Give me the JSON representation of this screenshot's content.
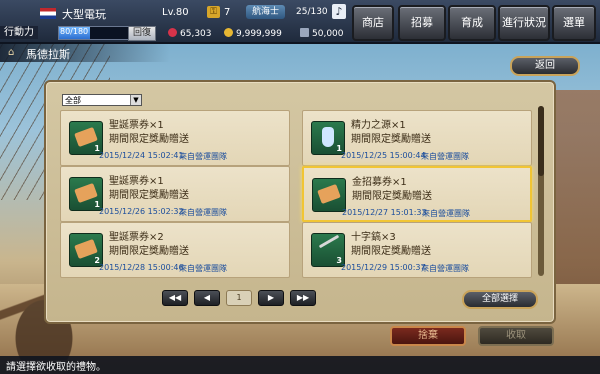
{
  "header": {
    "player_name": "大型電玩",
    "level": "Lv.80",
    "keys": "7",
    "job": "航海士",
    "crew": "25/130",
    "music_icon": "music-note-icon",
    "stamina_label": "行動力",
    "stamina_text": "80/180",
    "stamina_fraction": 0.44,
    "recover_label": "回復",
    "gems": "65,303",
    "gold": "9,999,999",
    "capacity": "50,000"
  },
  "nav": {
    "shop": "商店",
    "recruit": "招募",
    "training": "育成",
    "progress": "進行狀況",
    "menu": "選單"
  },
  "location": {
    "name": "馬德拉斯",
    "back_label": "返回"
  },
  "filter": {
    "selected": "全部"
  },
  "items": [
    {
      "name": "聖誕票券×1",
      "desc": "期間限定獎勵贈送",
      "date": "2015/12/24  15:02:41",
      "source": "來自營運團隊",
      "count": "1",
      "icon": "ticket"
    },
    {
      "name": "精力之源×1",
      "desc": "期間限定獎勵贈送",
      "date": "2015/12/25  15:00:44",
      "source": "來自營運團隊",
      "count": "1",
      "icon": "potion"
    },
    {
      "name": "聖誕票券×1",
      "desc": "期間限定獎勵贈送",
      "date": "2015/12/26  15:02:32",
      "source": "來自營運團隊",
      "count": "1",
      "icon": "ticket"
    },
    {
      "name": "金招募券×1",
      "desc": "期間限定獎勵贈送",
      "date": "2015/12/27  15:01:33",
      "source": "來自營運團隊",
      "count": "",
      "icon": "ticket",
      "selected": true
    },
    {
      "name": "聖誕票券×2",
      "desc": "期間限定獎勵贈送",
      "date": "2015/12/28  15:00:46",
      "source": "來自營運團隊",
      "count": "2",
      "icon": "ticket"
    },
    {
      "name": "十字鎬×3",
      "desc": "期間限定獎勵贈送",
      "date": "2015/12/29  15:00:37",
      "source": "來自營運團隊",
      "count": "3",
      "icon": "pickaxe"
    }
  ],
  "pager": {
    "first": "◀◀",
    "prev": "◀",
    "page": "1",
    "next": "▶",
    "last": "▶▶"
  },
  "actions": {
    "select_all": "全部選擇",
    "delete": "捨棄",
    "receive": "收取"
  },
  "status_text": "請選擇欲收取的禮物。"
}
